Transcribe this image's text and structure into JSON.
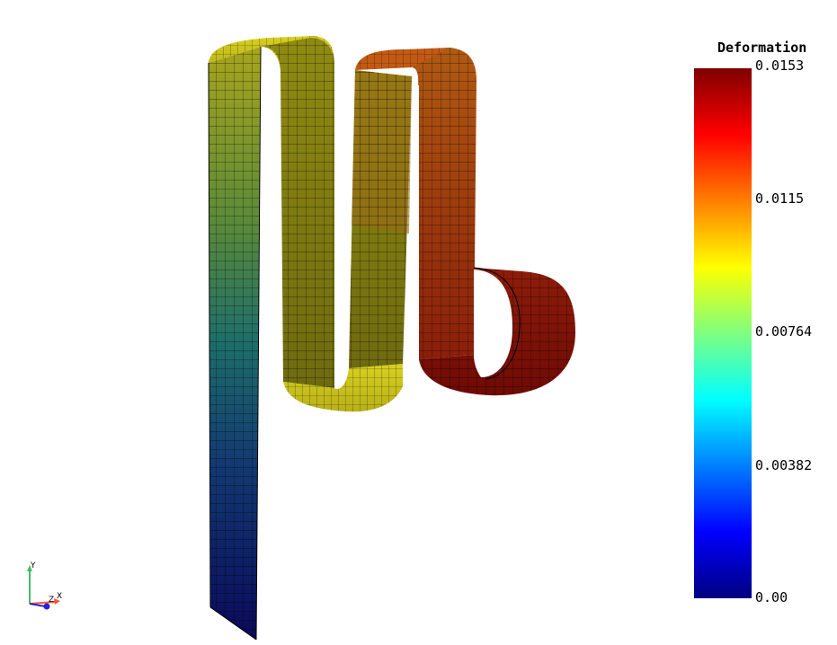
{
  "legend": {
    "title": "Deformation",
    "ticks": [
      "0.0153",
      "0.0115",
      "0.00764",
      "0.00382",
      "0.00"
    ],
    "colormap": [
      "#00007f",
      "#0000ff",
      "#007fff",
      "#00ffff",
      "#7fff7f",
      "#ffff00",
      "#ff7f00",
      "#ff0000",
      "#7f0000"
    ]
  },
  "triad": {
    "y_label": "Y",
    "x_label": "X",
    "z_label": "Z",
    "y_color": "#44bb66",
    "x_color": "#ff5533",
    "z_color": "#2222dd"
  },
  "model": {
    "min_deformation": 0.0,
    "max_deformation": 0.0153
  }
}
